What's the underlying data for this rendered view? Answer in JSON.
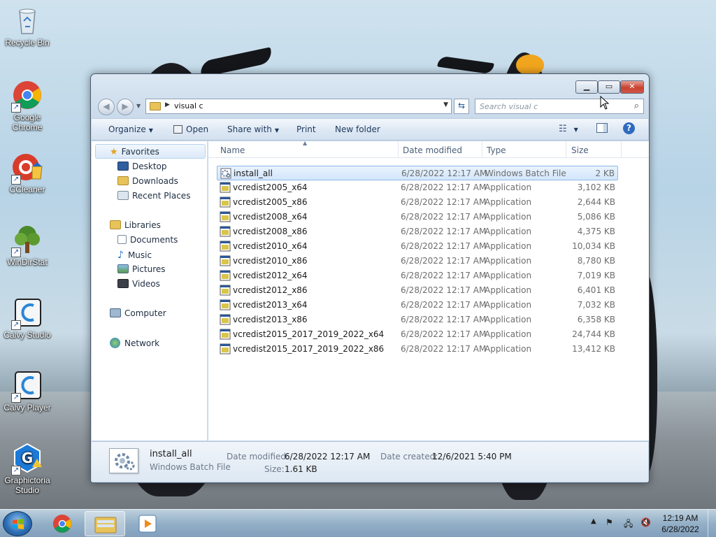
{
  "desktop": {
    "icons": [
      {
        "label": "Recycle Bin"
      },
      {
        "label": "Google Chrome"
      },
      {
        "label": "CCleaner"
      },
      {
        "label": "WinDirStat"
      },
      {
        "label": "Calvy Studio"
      },
      {
        "label": "Calvy Player"
      },
      {
        "label": "Graphictoria Studio"
      }
    ]
  },
  "window": {
    "address": {
      "path": "visual c"
    },
    "search": {
      "placeholder": "Search visual c"
    },
    "toolbar": {
      "organize": "Organize",
      "open": "Open",
      "share_with": "Share with",
      "print": "Print",
      "new_folder": "New folder"
    },
    "nav": {
      "favorites": "Favorites",
      "desktop": "Desktop",
      "downloads": "Downloads",
      "recent_places": "Recent Places",
      "libraries": "Libraries",
      "documents": "Documents",
      "music": "Music",
      "pictures": "Pictures",
      "videos": "Videos",
      "computer": "Computer",
      "network": "Network"
    },
    "columns": {
      "name": "Name",
      "date_modified": "Date modified",
      "type": "Type",
      "size": "Size"
    },
    "files": [
      {
        "name": "install_all",
        "date": "6/28/2022 12:17 AM",
        "type": "Windows Batch File",
        "size": "2 KB"
      },
      {
        "name": "vcredist2005_x64",
        "date": "6/28/2022 12:17 AM",
        "type": "Application",
        "size": "3,102 KB"
      },
      {
        "name": "vcredist2005_x86",
        "date": "6/28/2022 12:17 AM",
        "type": "Application",
        "size": "2,644 KB"
      },
      {
        "name": "vcredist2008_x64",
        "date": "6/28/2022 12:17 AM",
        "type": "Application",
        "size": "5,086 KB"
      },
      {
        "name": "vcredist2008_x86",
        "date": "6/28/2022 12:17 AM",
        "type": "Application",
        "size": "4,375 KB"
      },
      {
        "name": "vcredist2010_x64",
        "date": "6/28/2022 12:17 AM",
        "type": "Application",
        "size": "10,034 KB"
      },
      {
        "name": "vcredist2010_x86",
        "date": "6/28/2022 12:17 AM",
        "type": "Application",
        "size": "8,780 KB"
      },
      {
        "name": "vcredist2012_x64",
        "date": "6/28/2022 12:17 AM",
        "type": "Application",
        "size": "7,019 KB"
      },
      {
        "name": "vcredist2012_x86",
        "date": "6/28/2022 12:17 AM",
        "type": "Application",
        "size": "6,401 KB"
      },
      {
        "name": "vcredist2013_x64",
        "date": "6/28/2022 12:17 AM",
        "type": "Application",
        "size": "7,032 KB"
      },
      {
        "name": "vcredist2013_x86",
        "date": "6/28/2022 12:17 AM",
        "type": "Application",
        "size": "6,358 KB"
      },
      {
        "name": "vcredist2015_2017_2019_2022_x64",
        "date": "6/28/2022 12:17 AM",
        "type": "Application",
        "size": "24,744 KB"
      },
      {
        "name": "vcredist2015_2017_2019_2022_x86",
        "date": "6/28/2022 12:17 AM",
        "type": "Application",
        "size": "13,412 KB"
      }
    ],
    "details": {
      "name": "install_all",
      "type": "Windows Batch File",
      "date_modified_label": "Date modified:",
      "date_modified": "6/28/2022 12:17 AM",
      "size_label": "Size:",
      "size": "1.61 KB",
      "date_created_label": "Date created:",
      "date_created": "12/6/2021 5:40 PM"
    }
  },
  "taskbar": {
    "clock_time": "12:19 AM",
    "clock_date": "6/28/2022"
  },
  "colors": {
    "selection": "#d3e6fb",
    "accent": "#1e395b"
  }
}
